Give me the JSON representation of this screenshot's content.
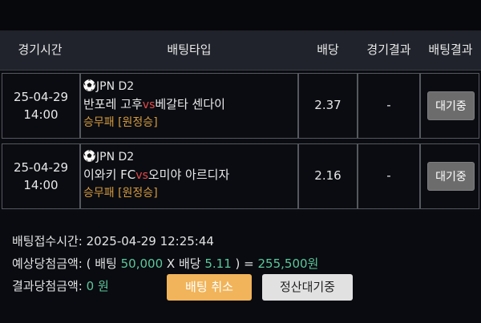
{
  "header": {
    "col_time": "경기시간",
    "col_type": "배팅타입",
    "col_odds": "배당",
    "col_result": "경기결과",
    "col_bet_result": "배팅결과"
  },
  "bets": [
    {
      "date": "25-04-29",
      "time": "14:00",
      "league": "JPN D2",
      "home": "반포레 고후",
      "vs": "vs",
      "away": "베갈타 센다이",
      "pick": "승무패 [원정승]",
      "odds": "2.37",
      "result": "-",
      "status": "대기중"
    },
    {
      "date": "25-04-29",
      "time": "14:00",
      "league": "JPN D2",
      "home": "이와키 FC",
      "vs": "vs",
      "away": "오미야 아르디자",
      "pick": "승무패 [원정승]",
      "odds": "2.16",
      "result": "-",
      "status": "대기중"
    }
  ],
  "summary": {
    "received_label": "배팅접수시간:",
    "received_value": "2025-04-29 12:25:44",
    "expected_label": "예상당첨금액: ( 배팅",
    "stake": "50,000",
    "times": "X 배당",
    "total_odds": "5.11",
    "close_eq": ") =",
    "expected_win": "255,500원",
    "result_label": "결과당첨금액:",
    "result_value": "0",
    "result_unit": "원"
  },
  "actions": {
    "cancel_label": "배팅 취소",
    "settle_label": "정산대기중"
  },
  "colors": {
    "accent_vs": "#e24a4a",
    "pick": "#d59a3e",
    "numbers": "#5cc79a",
    "cancel_button": "#f1b45a",
    "waiting_button": "#6c6c6c"
  }
}
